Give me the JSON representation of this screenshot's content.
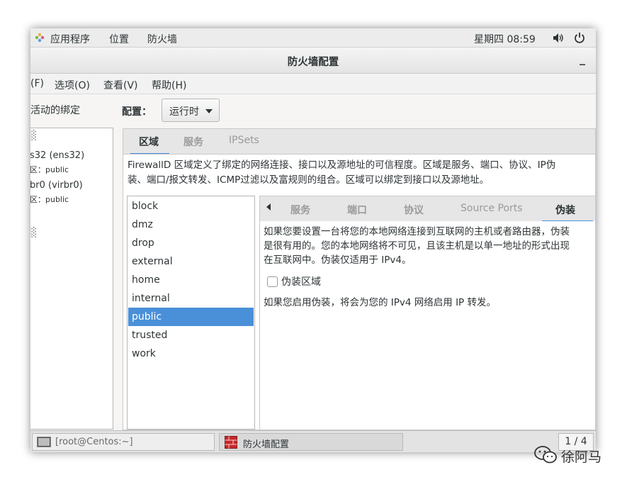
{
  "topbar": {
    "applications": "应用程序",
    "places": "位置",
    "app_name": "防火墙",
    "clock": "星期四 08:59",
    "volume_icon": "speaker-icon",
    "power_icon": "power-icon"
  },
  "window": {
    "title": "防火墙配置",
    "minimize": "_"
  },
  "menubar": {
    "file": "(F)",
    "options": "选项(O)",
    "view": "查看(V)",
    "help": "帮助(H)"
  },
  "left_panel": {
    "title": "活动的绑定",
    "header": "░",
    "connections": [
      {
        "name": "s32 (ens32)",
        "zone_label": "区：public"
      },
      {
        "name": "br0 (virbr0)",
        "zone_label": "区：public"
      }
    ],
    "extra": "░"
  },
  "config": {
    "label": "配置：",
    "value": "运行时"
  },
  "main_tabs": [
    {
      "label": "区域",
      "active": true
    },
    {
      "label": "服务",
      "active": false
    },
    {
      "label": "IPSets",
      "active": false
    }
  ],
  "zone_description": {
    "line1": "FirewallD 区域定义了绑定的网络连接、接口以及源地址的可信程度。区域是服务、端口、协议、IP伪",
    "line2": "装、端口/报文转发、ICMP过滤以及富规则的组合。区域可以绑定到接口以及源地址。"
  },
  "zones": [
    "block",
    "dmz",
    "drop",
    "external",
    "home",
    "internal",
    "public",
    "trusted",
    "work"
  ],
  "selected_zone": "public",
  "sub_tabs": [
    {
      "label": "服务",
      "active": false
    },
    {
      "label": "端口",
      "active": false
    },
    {
      "label": "协议",
      "active": false
    },
    {
      "label": "Source Ports",
      "active": false
    },
    {
      "label": "伪装",
      "active": true
    }
  ],
  "masquerade": {
    "desc_line1": "如果您要设置一台将您的本地网络连接到互联网的主机或者路由器，伪装",
    "desc_line2": "是很有用的。您的本地网络将不可见，且该主机是以单一地址的形式出现",
    "desc_line3": "在互联网中。伪装仅适用于 IPv4。",
    "checkbox_label": "伪装区域",
    "checked": false,
    "note": "如果您启用伪装，将会为您的 IPv4 网络启用 IP 转发。"
  },
  "taskbar": {
    "terminal": "[root@Centos:~]",
    "firewall": "防火墙配置",
    "workspace": "1 / 4"
  },
  "watermark": {
    "text": "徐阿马"
  },
  "colors": {
    "accent": "#4a90d9",
    "background": "#f6f5f4"
  }
}
